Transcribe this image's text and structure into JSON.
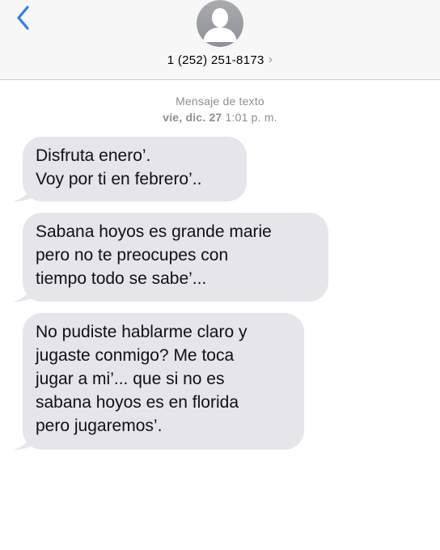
{
  "header": {
    "back_icon": "chevron-left-icon",
    "avatar_icon": "person-silhouette-icon",
    "contact_number": "1 (252) 251-8173",
    "contact_chevron": "›",
    "accent_color": "#2f7cf6"
  },
  "thread": {
    "service_label": "Mensaje de texto",
    "date_label": "vie, dic. 27",
    "time_label": "1:01 p. m."
  },
  "messages": [
    {
      "lines": [
        "Disfruta enero’.",
        "Voy por ti en febrero’.."
      ]
    },
    {
      "lines": [
        "Sabana hoyos es grande marie",
        "pero no te preocupes con",
        "tiempo todo se sabe’..."
      ]
    },
    {
      "lines": [
        "No pudiste hablarme claro y",
        "jugaste conmigo? Me toca",
        "jugar a mi’... que si no es",
        "sabana hoyos es en florida",
        "pero jugaremos’."
      ]
    }
  ],
  "colors": {
    "bubble": "#e5e5ea",
    "header_bg": "#f7f7f7",
    "meta_text": "#8e8e93"
  }
}
